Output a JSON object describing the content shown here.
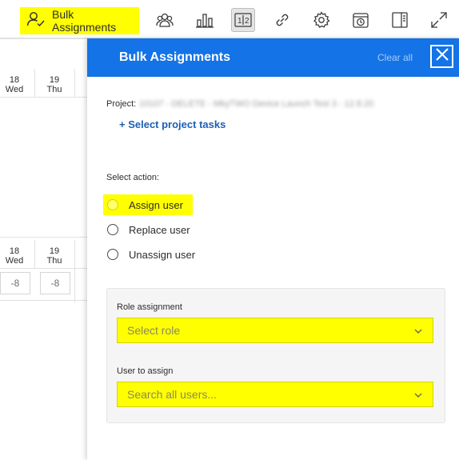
{
  "toolbar": {
    "bulk_label": "Bulk Assignments",
    "icons": [
      "team-icon",
      "chart-icon",
      "one-two-icon",
      "link-icon",
      "gear-icon",
      "calendar-clock-icon",
      "panel-icon",
      "expand-icon"
    ]
  },
  "grid": {
    "days_top": [
      {
        "num": "18",
        "dow": "Wed"
      },
      {
        "num": "19",
        "dow": "Thu"
      }
    ],
    "days_bottom": [
      {
        "num": "18",
        "dow": "Wed"
      },
      {
        "num": "19",
        "dow": "Thu"
      }
    ],
    "hours": [
      "-8",
      "-8"
    ]
  },
  "panel": {
    "title": "Bulk Assignments",
    "clear_all": "Clear all",
    "project_label": "Project:",
    "project_value": "10107 - DELETE - MkyTWO Device Launch Test 3 - 12.8.20",
    "select_tasks": "+ Select project tasks",
    "select_action_label": "Select action:",
    "actions": [
      "Assign user",
      "Replace user",
      "Unassign user"
    ],
    "selected_action": "Assign user",
    "role_label": "Role assignment",
    "role_placeholder": "Select role",
    "user_label": "User to assign",
    "user_placeholder": "Search all users..."
  },
  "colors": {
    "accent_blue": "#1473e6",
    "highlight": "#ffff00",
    "link": "#1c5fb8"
  }
}
